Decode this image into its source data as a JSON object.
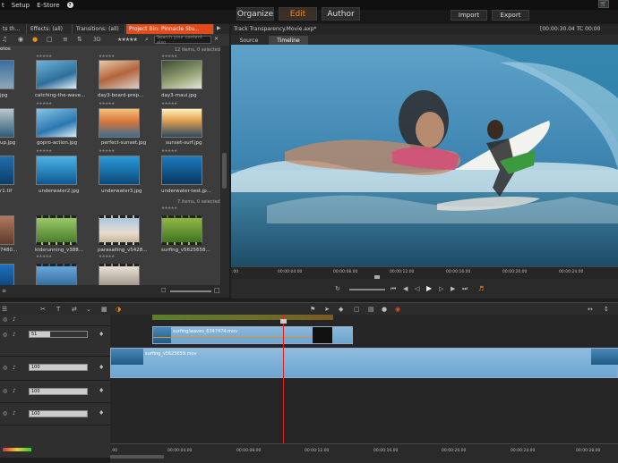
{
  "menu": {
    "items": [
      "t",
      "Setup",
      "E-Store"
    ],
    "help_icon": "?"
  },
  "modes": {
    "organize": "Organize",
    "edit": "Edit",
    "author": "Author",
    "import": "Import",
    "export": "Export"
  },
  "library": {
    "tabs": [
      {
        "label": "ts th..."
      },
      {
        "label": "Effects: (all)"
      },
      {
        "label": "Transitions: (all)"
      },
      {
        "label": "Project Bin: Pinnacle Stu..."
      }
    ],
    "section_label": "otos",
    "toolbar_3d": "3D",
    "search_placeholder": "Search your content also",
    "photos_count": "12 items, 0 selected",
    "videos_count": "7 items, 0 selected",
    "photo_labels": [
      [
        "jpg",
        "catching-the-wave...",
        "day3-board-prep...",
        "day3-maui.jpg"
      ],
      [
        "up.jpg",
        "gopro-action.jpg",
        "perfect-sunset.jpg",
        "sunset-surf.jpg"
      ],
      [
        "r1.tif",
        "underwater2.jpg",
        "underwater3.jpg",
        "underwater-test.jp..."
      ]
    ],
    "video_labels": [
      "7480...",
      "kidsrunning_v388...",
      "parasailing_v5428...",
      "surfing_v5625658..."
    ]
  },
  "player": {
    "project_name": "Track Transparency.Movie.axp*",
    "timecode": "[00:00:30.04  TC 00:00",
    "tabs": {
      "source": "Source",
      "timeline": "Timeline"
    },
    "ruler": [
      ".00",
      "00:00:04.00",
      "00:00:08.00",
      "00:00:12.00",
      "00:00:16.00",
      "00:00:20.00",
      "00:00:24.00"
    ]
  },
  "timeline": {
    "tracks": [
      {
        "volume": "51"
      },
      {
        "volume": "100"
      },
      {
        "volume": "100"
      },
      {
        "volume": "100"
      }
    ],
    "clip_upper": "surfing/waves_6347474.mov",
    "clip_main": "surfing_v5625659.mov",
    "ruler": [
      ".00",
      "00:00:04.00",
      "00:00:08.00",
      "00:00:12.00",
      "00:00:16.00",
      "00:00:20.00",
      "00:00:24.00",
      "00:00:28.00"
    ]
  },
  "colors": {
    "accent": "#f08a1c",
    "active_tab": "#e24a1a",
    "clip_blue": "#6aa6d2",
    "playhead": "#e02020"
  }
}
